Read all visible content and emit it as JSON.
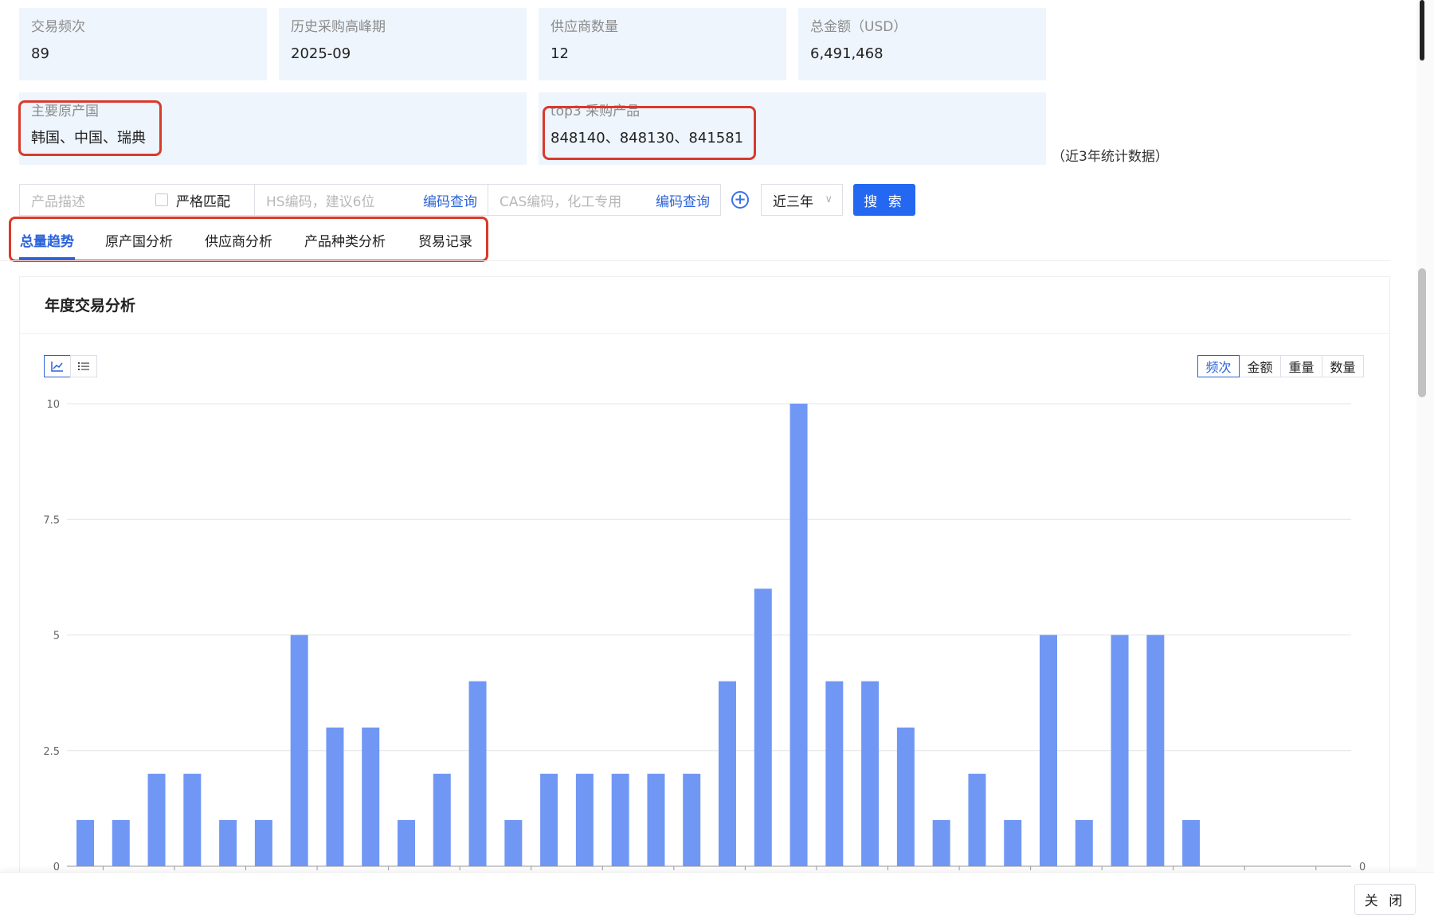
{
  "stats": [
    {
      "label": "交易频次",
      "value": "89"
    },
    {
      "label": "历史采购高峰期",
      "value": "2025-09"
    },
    {
      "label": "供应商数量",
      "value": "12"
    },
    {
      "label": "总金额（USD）",
      "value": "6,491,468"
    }
  ],
  "origin": {
    "label": "主要原产国",
    "value": "韩国、中国、瑞典"
  },
  "top_products": {
    "label": "top3 采购产品",
    "value": "848140、848130、841581"
  },
  "stats_note": "（近3年统计数据）",
  "search": {
    "product_placeholder": "产品描述",
    "strict_label": "严格匹配",
    "hs_placeholder": "HS编码，建议6位",
    "hs_lookup": "编码查询",
    "cas_placeholder": "CAS编码，化工专用",
    "cas_lookup": "编码查询",
    "period": "近三年",
    "search_button": "搜 索"
  },
  "tabs": [
    "总量趋势",
    "原产国分析",
    "供应商分析",
    "产品种类分析",
    "贸易记录"
  ],
  "panel": {
    "title": "年度交易分析",
    "metrics": [
      "频次",
      "金额",
      "重量",
      "数量"
    ]
  },
  "chart_data": {
    "type": "bar",
    "title": "",
    "xlabel": "",
    "ylabel": "",
    "ylim": [
      0,
      10
    ],
    "yticks": [
      "0",
      "2.5",
      "5",
      "7.5",
      "10"
    ],
    "y2_tick": "0",
    "bar_color": "#7197f5",
    "values": [
      1,
      1,
      2,
      2,
      1,
      1,
      5,
      3,
      3,
      1,
      2,
      4,
      1,
      2,
      2,
      2,
      2,
      2,
      4,
      6,
      10,
      4,
      4,
      3,
      1,
      2,
      1,
      5,
      1,
      5,
      5,
      1,
      0,
      0,
      0,
      0
    ],
    "grid": true
  },
  "footer": {
    "close_button": "关 闭"
  },
  "colors": {
    "accent": "#2468f2",
    "highlight": "#d93a2b",
    "card_bg": "#eef5fd"
  }
}
